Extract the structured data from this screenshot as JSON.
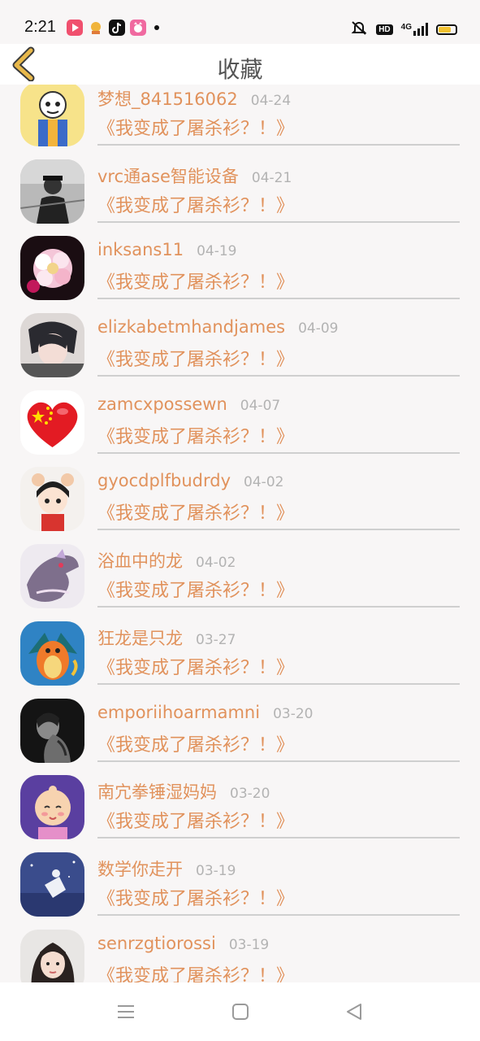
{
  "status_bar": {
    "time": "2:21",
    "hd_badge": "HD",
    "network_label": "4G",
    "battery_level": 0.75,
    "notification_icons": [
      "video-app-icon",
      "mascot-app-icon",
      "tiktok-icon",
      "cat-app-icon"
    ]
  },
  "header": {
    "title": "收藏",
    "back_icon": "chevron-left-icon"
  },
  "items": [
    {
      "username": "梦想_841516062",
      "date": "04-24",
      "title": "《我变成了屠杀衫？！》",
      "avatar": "cartoon-skeleton-avatar"
    },
    {
      "username": "vrc通ase智能设备",
      "date": "04-21",
      "title": "《我变成了屠杀衫？！》",
      "avatar": "bw-photo-avatar"
    },
    {
      "username": "inksans11",
      "date": "04-19",
      "title": "《我变成了屠杀衫？！》",
      "avatar": "pink-flower-avatar"
    },
    {
      "username": "elizkabetmhandjames",
      "date": "04-09",
      "title": "《我变成了屠杀衫？！》",
      "avatar": "anime-boy-avatar"
    },
    {
      "username": "zamcxpossewn",
      "date": "04-07",
      "title": "《我变成了屠杀衫？！》",
      "avatar": "flag-heart-avatar"
    },
    {
      "username": "gyocdplfbudrdy",
      "date": "04-02",
      "title": "《我变成了屠杀衫？！》",
      "avatar": "anime-girl-avatar"
    },
    {
      "username": "浴血中的龙",
      "date": "04-02",
      "title": "《我变成了屠杀衫？！》",
      "avatar": "dragon-avatar"
    },
    {
      "username": "狂龙是只龙",
      "date": "03-27",
      "title": "《我变成了屠杀衫？！》",
      "avatar": "charizard-avatar"
    },
    {
      "username": "emporiihoarmamni",
      "date": "03-20",
      "title": "《我变成了屠杀衫？！》",
      "avatar": "dark-portrait-avatar"
    },
    {
      "username": "南宂拳锤湿妈妈",
      "date": "03-20",
      "title": "《我变成了屠杀衫？！》",
      "avatar": "baby-avatar"
    },
    {
      "username": "数学你走开",
      "date": "03-19",
      "title": "《我变成了屠杀衫？！》",
      "avatar": "night-scene-avatar"
    },
    {
      "username": "senrzgtiorossi",
      "date": "03-19",
      "title": "《我变成了屠杀衫？！》",
      "avatar": "girl-portrait-avatar"
    }
  ],
  "nav_bar": {
    "menu_icon": "menu-icon",
    "home_icon": "home-square-icon",
    "back_icon": "back-triangle-icon"
  },
  "colors": {
    "accent": "#e1925c",
    "date": "#b3b3b3",
    "background": "#f8f6f6",
    "back_arrow": "#e8b84a"
  }
}
